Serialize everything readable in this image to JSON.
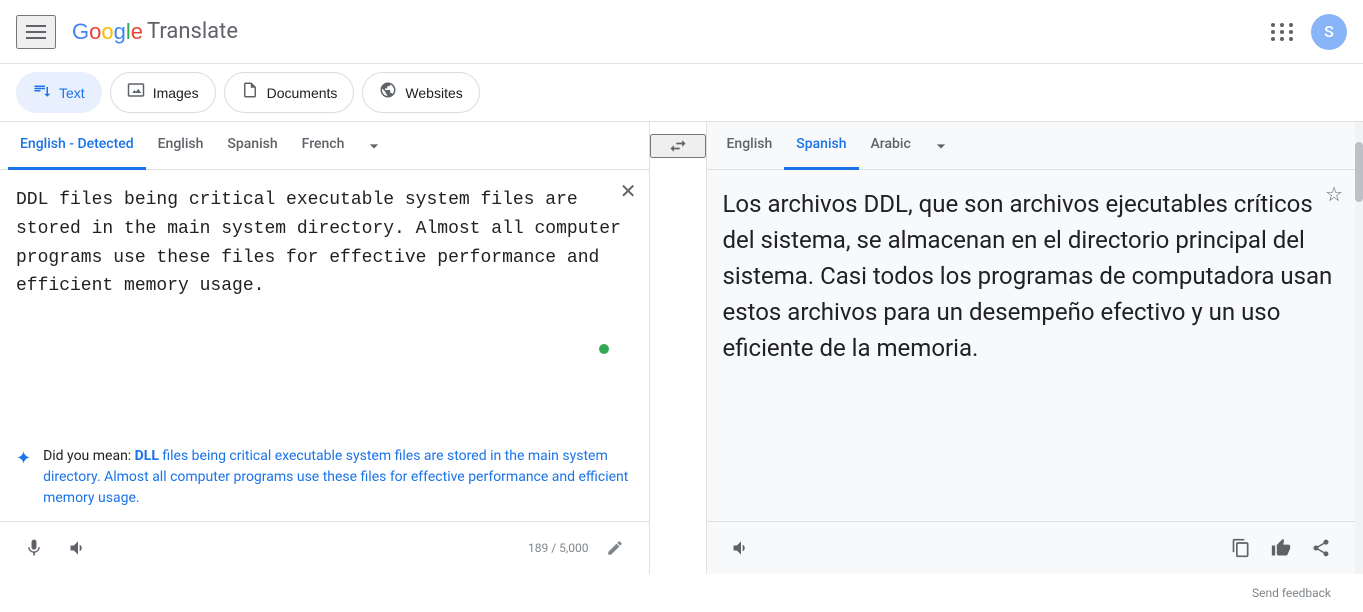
{
  "header": {
    "menu_label": "Main menu",
    "logo_text_google": "Google",
    "logo_text_translate": " Translate",
    "apps_label": "Google apps",
    "avatar_letter": "S"
  },
  "mode_tabs": [
    {
      "id": "text",
      "label": "Text",
      "icon": "🔤",
      "active": true
    },
    {
      "id": "images",
      "label": "Images",
      "icon": "🖼",
      "active": false
    },
    {
      "id": "documents",
      "label": "Documents",
      "icon": "📄",
      "active": false
    },
    {
      "id": "websites",
      "label": "Websites",
      "icon": "🌐",
      "active": false
    }
  ],
  "source": {
    "lang_tabs": [
      {
        "id": "detected",
        "label": "English - Detected",
        "active": true
      },
      {
        "id": "english",
        "label": "English",
        "active": false
      },
      {
        "id": "spanish",
        "label": "Spanish",
        "active": false
      },
      {
        "id": "french",
        "label": "French",
        "active": false
      }
    ],
    "more_label": "▾",
    "source_text": "DDL files being critical executable system files are stored in the main system directory. Almost all computer programs use these files for effective performance and efficient memory usage.",
    "char_count": "189 / 5,000",
    "did_you_mean_prefix": "Did you mean: ",
    "did_you_mean_link_bold": "DLL",
    "did_you_mean_link_rest": " files being critical executable system files are stored in the main system directory. Almost all computer programs use these files for effective performance and efficient memory usage."
  },
  "target": {
    "lang_tabs": [
      {
        "id": "english",
        "label": "English",
        "active": false
      },
      {
        "id": "spanish",
        "label": "Spanish",
        "active": true
      },
      {
        "id": "arabic",
        "label": "Arabic",
        "active": false
      }
    ],
    "more_label": "▾",
    "translated_text": "Los archivos DDL, que son archivos ejecutables críticos del sistema, se almacenan en el directorio principal del sistema. Casi todos los programas de computadora usan estos archivos para un desempeño efectivo y un uso eficiente de la memoria."
  },
  "footer": {
    "send_feedback": "Send feedback"
  },
  "icons": {
    "menu": "☰",
    "close": "✕",
    "mic": "🎤",
    "volume": "🔊",
    "pencil": "✏",
    "copy": "⧉",
    "thumbs": "👍",
    "share": "⤴",
    "star": "☆",
    "swap": "⇄",
    "sparkle": "✦"
  }
}
